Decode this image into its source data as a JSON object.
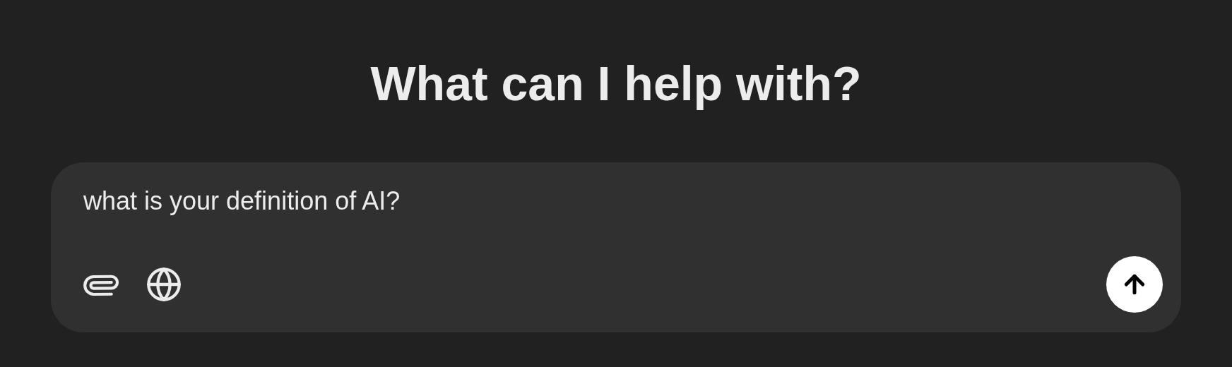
{
  "heading": "What can I help with?",
  "composer": {
    "value": "what is your definition of AI?"
  }
}
